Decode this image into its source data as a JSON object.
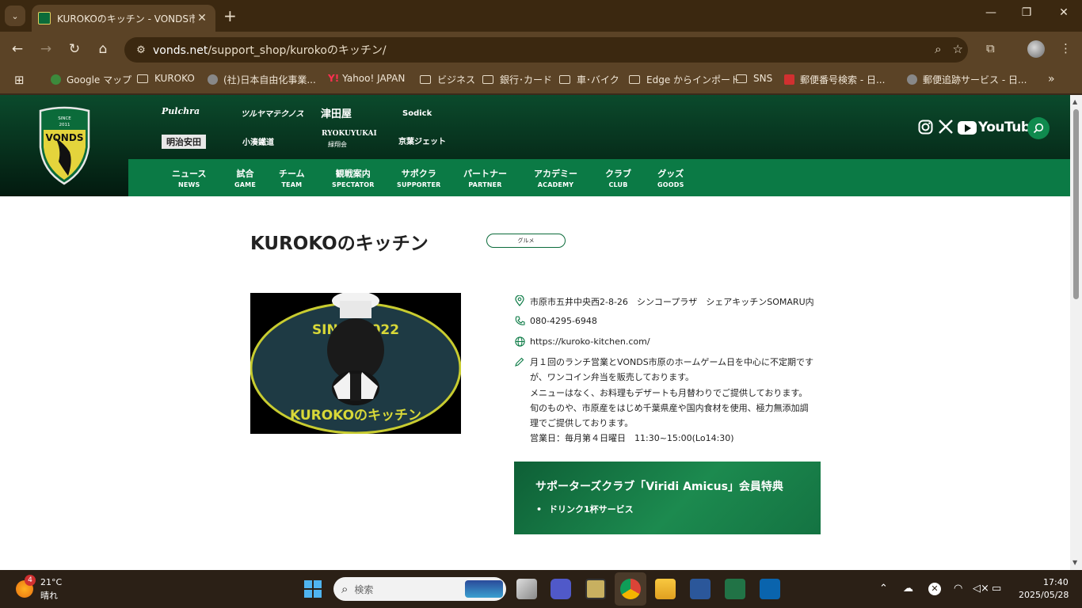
{
  "browser": {
    "tab_title": "KUROKOのキッチン - VONDS市原",
    "url_domain": "vonds.net",
    "url_path": "/support_shop/kurokoのキッチン/",
    "bookmarks": [
      "Google マップ",
      "KUROKO",
      "(社)日本自由化事業...",
      "Yahoo! JAPAN",
      "ビジネス",
      "銀行･カード",
      "車･バイク",
      "Edge からインポート",
      "SNS",
      "郵便番号検索 - 日...",
      "郵便追跡サービス - 日..."
    ],
    "yahoo_mark": "Y!"
  },
  "site": {
    "crest_since": "SINCE",
    "crest_year": "2011",
    "crest_name": "VONDS",
    "sponsors": [
      "Pulchra",
      "ツルヤマテクノス",
      "津田屋",
      "Sodick",
      "明治安田",
      "小湊鐵道",
      "RYOKUYUKAI",
      "京葉ジェット"
    ],
    "sponsor_sub": "緑翔会",
    "social_youtube": "YouTube",
    "nav": [
      {
        "jp": "ニュース",
        "en": "NEWS"
      },
      {
        "jp": "試合",
        "en": "GAME"
      },
      {
        "jp": "チーム",
        "en": "TEAM"
      },
      {
        "jp": "観戦案内",
        "en": "SPECTATOR"
      },
      {
        "jp": "サポクラ",
        "en": "SUPPORTER"
      },
      {
        "jp": "パートナー",
        "en": "PARTNER"
      },
      {
        "jp": "アカデミー",
        "en": "ACADEMY"
      },
      {
        "jp": "クラブ",
        "en": "CLUB"
      },
      {
        "jp": "グッズ",
        "en": "GOODS"
      }
    ]
  },
  "shop": {
    "title": "KUROKOのキッチン",
    "category": "グルメ",
    "image_text_top": "SINCE 2022",
    "image_text_bottom": "KUROKOのキッチン",
    "address": "市原市五井中央西2-8-26　シンコープラザ　シェアキッチンSOMARU内",
    "phone": "080-4295-6948",
    "website": "https://kuroko-kitchen.com/",
    "description": [
      "月１回のランチ営業とVONDS市原のホームゲーム日を中心に不定期です",
      "が、ワンコイン弁当を販売しております。",
      "メニューはなく、お料理もデザートも月替わりでご提供しております。",
      "旬のものや、市原産をはじめ千葉県産や国内食材を使用、極力無添加調",
      "理でご提供しております。",
      "営業日：毎月第４日曜日　11:30~15:00(Lo14:30)"
    ],
    "benefit_title": "サポーターズクラブ「Viridi Amicus」会員特典",
    "benefit_items": [
      "ドリンク1杯サービス"
    ]
  },
  "taskbar": {
    "weather_badge": "4",
    "temperature": "21°C",
    "weather": "晴れ",
    "search_placeholder": "検索",
    "time": "17:40",
    "date": "2025/05/28"
  }
}
